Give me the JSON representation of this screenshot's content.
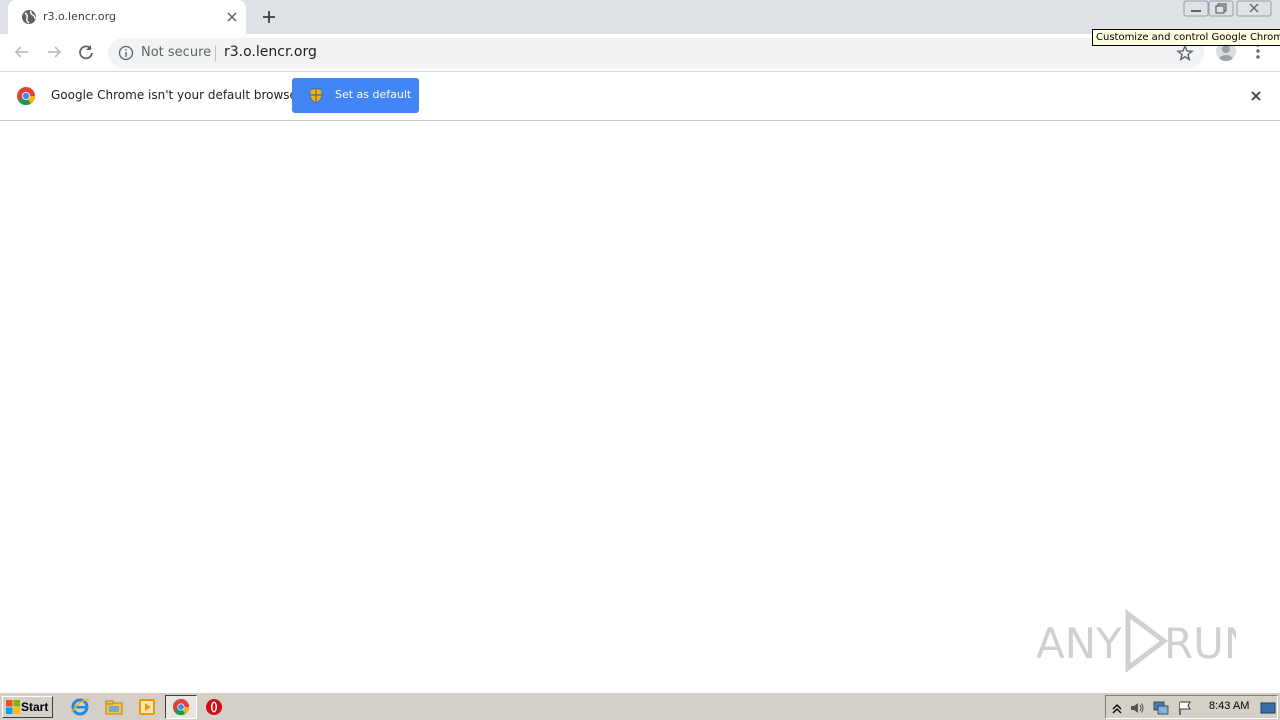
{
  "tab": {
    "title": "r3.o.lencr.org"
  },
  "omnibox": {
    "security_label": "Not secure",
    "url": "r3.o.lencr.org"
  },
  "tooltip": "Customize and control Google Chrome",
  "infobar": {
    "message": "Google Chrome isn't your default browser",
    "button_label": "Set as default"
  },
  "colors": {
    "accent": "#4285f4",
    "tabstrip": "#dee1e6",
    "omnibox_bg": "#f1f3f4",
    "taskbar": "#d4d0c8"
  },
  "taskbar": {
    "start_label": "Start",
    "pinned": [
      "internet-explorer-icon",
      "file-explorer-icon",
      "media-player-icon",
      "chrome-icon",
      "opera-icon"
    ],
    "clock": "8:43 AM"
  },
  "watermark": "ANY RUN"
}
